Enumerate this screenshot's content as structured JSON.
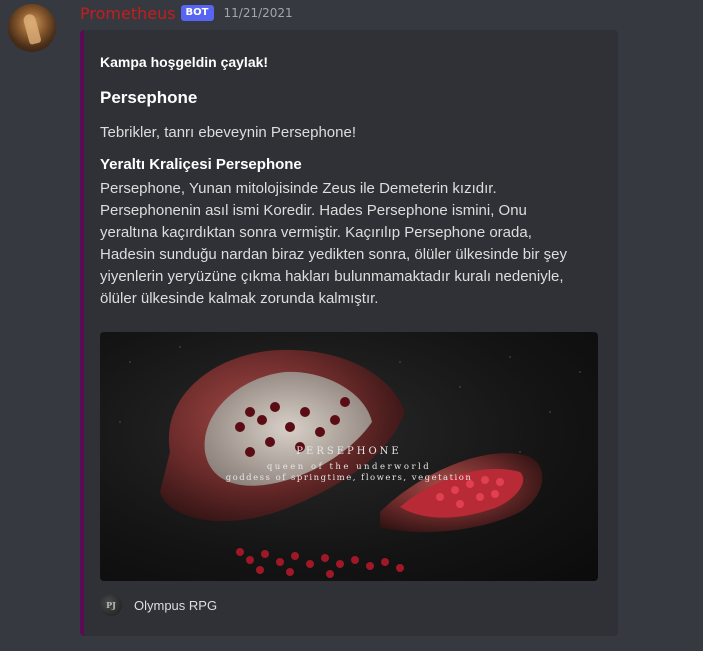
{
  "message": {
    "username": "Prometheus",
    "bot_tag": "BOT",
    "timestamp": "11/21/2021",
    "avatar_icon": "titan-avatar"
  },
  "embed": {
    "accent_color": "#5b0a55",
    "author": "Kampa hoşgeldin çaylak!",
    "title": "Persephone",
    "description": "Tebrikler, tanrı ebeveynin Persephone!",
    "field": {
      "name": "Yeraltı Kraliçesi Persephone",
      "value": "Persephone, Yunan mitolojisinde Zeus ile Demeterin kızıdır. Persephonenin asıl ismi Koredir. Hades Persephone ismini, Onu yeraltına kaçırdıktan sonra vermiştir. Kaçırılıp Persephone orada, Hadesin sunduğu nardan biraz yedikten sonra, ölüler ülkesinde bir şey yiyenlerin yeryüzüne çıkma hakları bulunmamaktadır kuralı nedeniyle, ölüler ülkesinde kalmak zorunda kalmıştır."
    },
    "image": {
      "line1": "PERSEPHONE",
      "line2": "queen of the underworld",
      "line3": "goddess of springtime, flowers, vegetation"
    },
    "footer": {
      "icon_text": "PJ",
      "text": "Olympus RPG"
    }
  }
}
